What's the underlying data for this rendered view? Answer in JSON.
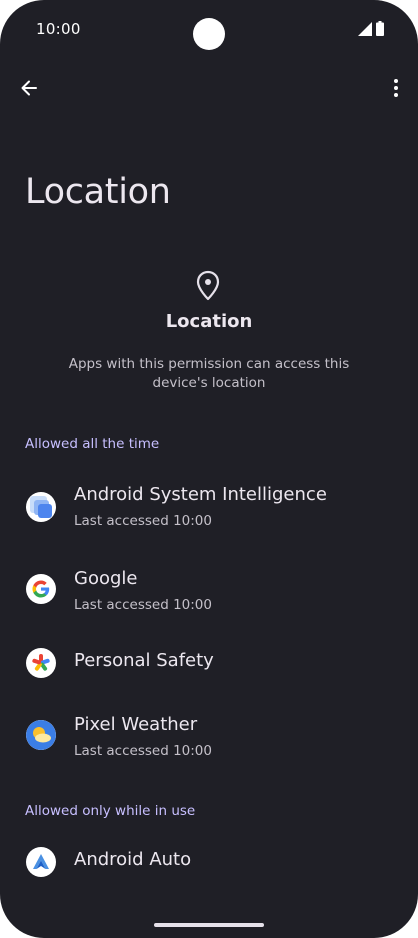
{
  "status_bar": {
    "time": "10:00",
    "icons": [
      "camera-cutout",
      "signal-icon",
      "battery-icon"
    ]
  },
  "toolbar": {
    "back_icon": "back-arrow-icon",
    "more_icon": "more-vert-icon"
  },
  "page": {
    "title": "Location"
  },
  "header": {
    "icon": "location-pin-icon",
    "title": "Location",
    "description": "Apps with this permission can access this device's location"
  },
  "sections": [
    {
      "title": "Allowed all the time",
      "apps": [
        {
          "name": "Android System Intelligence",
          "subtitle": "Last accessed 10:00",
          "icon": "android-system-intelligence-icon"
        },
        {
          "name": "Google",
          "subtitle": "Last accessed 10:00",
          "icon": "google-icon"
        },
        {
          "name": "Personal Safety",
          "subtitle": "",
          "icon": "personal-safety-icon"
        },
        {
          "name": "Pixel Weather",
          "subtitle": "Last accessed 10:00",
          "icon": "pixel-weather-icon"
        }
      ]
    },
    {
      "title": "Allowed only while in use",
      "apps": [
        {
          "name": "Android Auto",
          "subtitle": "",
          "icon": "android-auto-icon"
        }
      ]
    }
  ],
  "colors": {
    "background": "#1f1f26",
    "accent": "#c7bfff",
    "text_primary": "#ece7ef",
    "text_secondary": "#c4c0c9"
  }
}
